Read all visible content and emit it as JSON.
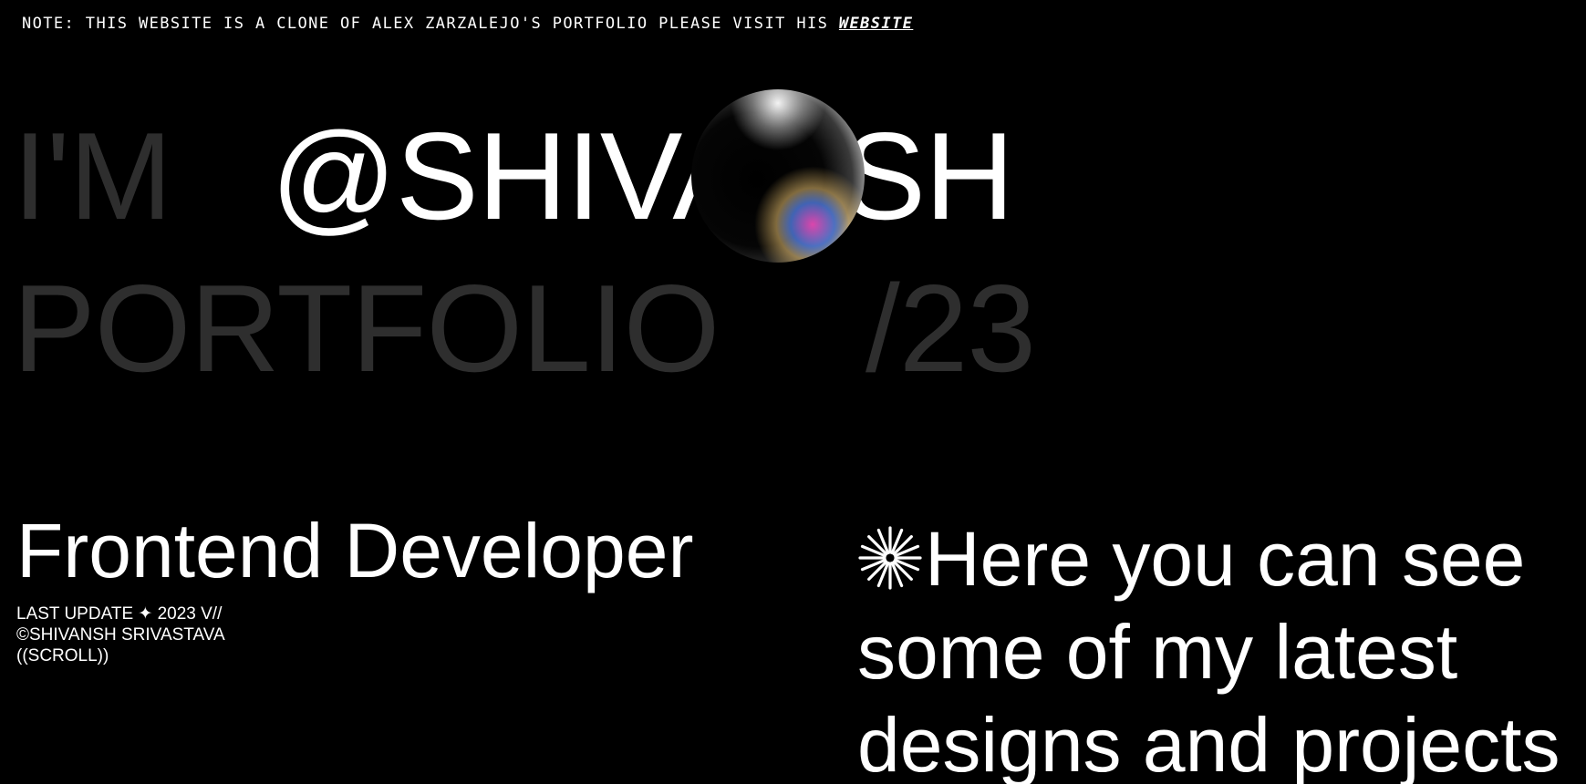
{
  "notice": {
    "text": "NOTE: THIS WEBSITE IS A CLONE OF ALEX ZARZALEJO'S PORTFOLIO PLEASE VISIT HIS ",
    "link_label": "WEBSITE"
  },
  "hero": {
    "greeting": "I'M",
    "handle": "@SHIVANSH",
    "portfolio_label": "PORTFOLIO",
    "year": "/23"
  },
  "role": "Frontend Developer",
  "meta": {
    "last_update": "LAST UPDATE ✦ 2023 V//",
    "copyright": "©SHIVANSH SRIVASTAVA",
    "scroll": "((SCROLL))"
  },
  "intro": {
    "icon": "asterisk-burst-icon",
    "line1": "Here you can see",
    "line2": "some of my latest",
    "line3": "designs and projects"
  },
  "colors": {
    "background": "#000000",
    "text": "#ffffff",
    "dim_text": "#2e2e2e"
  }
}
